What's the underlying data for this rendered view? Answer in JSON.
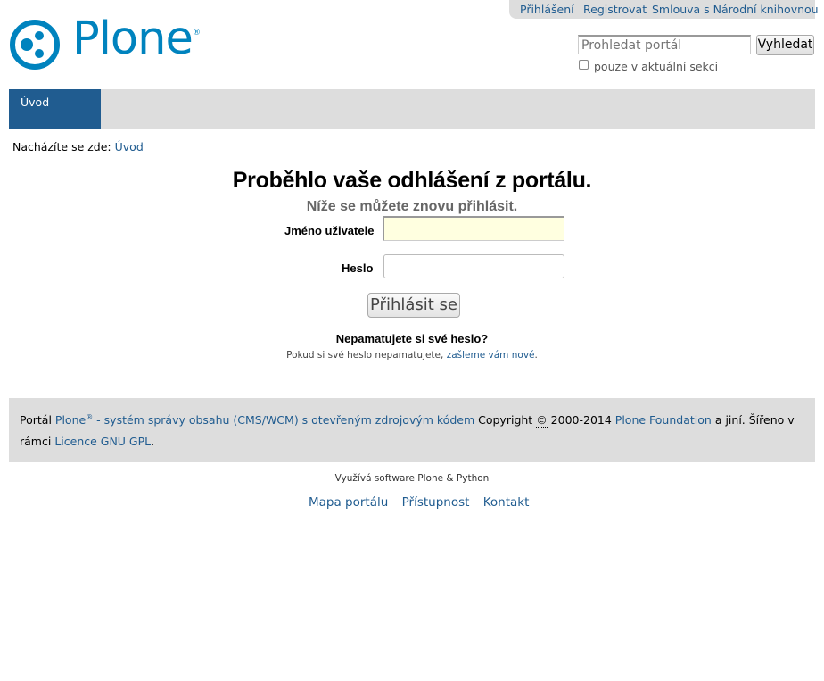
{
  "personal_tools": {
    "login": "Přihlášení",
    "register": "Registrovat",
    "agreement": "Smlouva s Národní knihovnou"
  },
  "logo": {
    "text": "Plone",
    "reg": "®"
  },
  "search": {
    "placeholder": "Prohledat portál",
    "button": "Vyhledat",
    "section_only": "pouze v aktuální sekci",
    "section_only_checked": false
  },
  "nav": {
    "tabs": [
      {
        "label": "Úvod",
        "selected": true
      }
    ]
  },
  "breadcrumb": {
    "prefix": "Nacházíte se zde:",
    "home": "Úvod"
  },
  "main": {
    "title": "Proběhlo vaše odhlášení z portálu.",
    "subtitle": "Níže se můžete znovu přihlásit.",
    "username_label": "Jméno uživatele",
    "username_value": "",
    "password_label": "Heslo",
    "password_value": "",
    "login_button": "Přihlásit se",
    "forgot_title": "Nepamatujete si své heslo?",
    "forgot_text": "Pokud si své heslo nepamatujete,",
    "forgot_link": "zašleme vám nové",
    "forgot_end": "."
  },
  "footer": {
    "t1": "Portál",
    "plone": "Plone",
    "reg": "®",
    "cms_link": "- systém správy obsahu (CMS/WCM) s otevřeným zdrojovým kódem",
    "t2": "Copyright",
    "copy": "©",
    "t3": "2000-2014",
    "foundation": "Plone Foundation",
    "t4": "a jiní. Šířeno v rámci",
    "license": "Licence GNU GPL",
    "end": "."
  },
  "colophon": "Využívá software Plone & Python",
  "site_actions": [
    "Mapa portálu",
    "Přístupnost",
    "Kontakt"
  ],
  "colors": {
    "brand": "#0083be",
    "link": "#205c90",
    "bar": "#dddddd"
  }
}
